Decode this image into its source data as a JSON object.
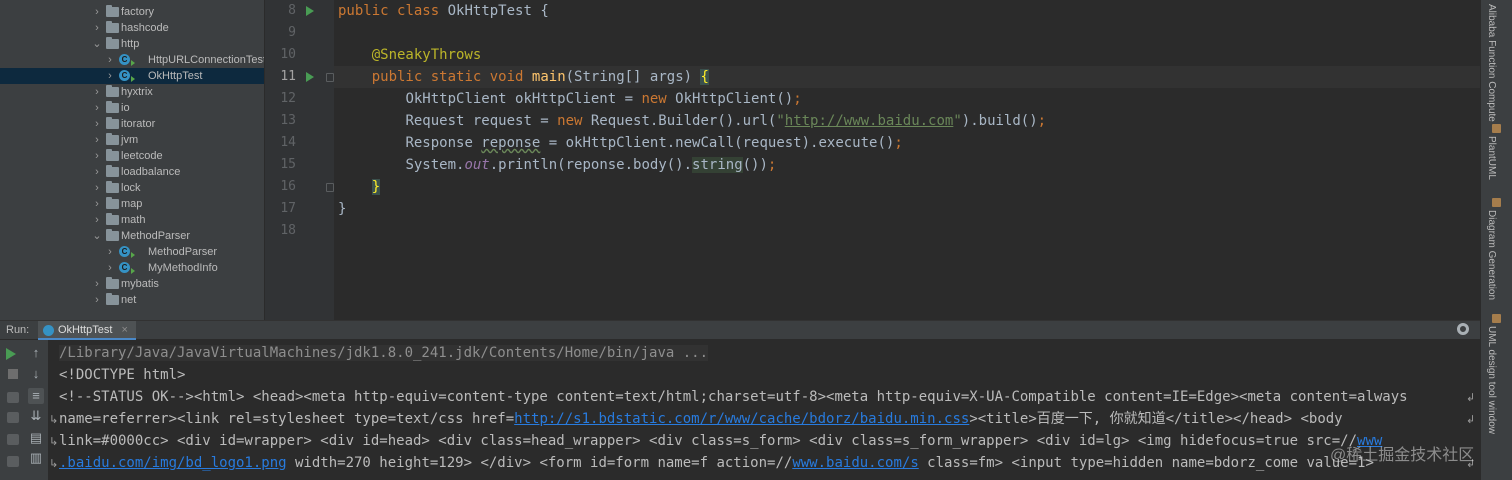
{
  "project_tree": {
    "items": [
      {
        "label": "factory",
        "kind": "folder",
        "expanded": false,
        "depth": 0
      },
      {
        "label": "hashcode",
        "kind": "folder",
        "expanded": false,
        "depth": 0
      },
      {
        "label": "http",
        "kind": "folder",
        "expanded": true,
        "depth": 0
      },
      {
        "label": "HttpURLConnectionTest",
        "kind": "class",
        "expanded": false,
        "depth": 1
      },
      {
        "label": "OkHttpTest",
        "kind": "class",
        "expanded": false,
        "depth": 1,
        "selected": true
      },
      {
        "label": "hyxtrix",
        "kind": "folder",
        "expanded": false,
        "depth": 0
      },
      {
        "label": "io",
        "kind": "folder",
        "expanded": false,
        "depth": 0
      },
      {
        "label": "itorator",
        "kind": "folder",
        "expanded": false,
        "depth": 0
      },
      {
        "label": "jvm",
        "kind": "folder",
        "expanded": false,
        "depth": 0
      },
      {
        "label": "leetcode",
        "kind": "folder",
        "expanded": false,
        "depth": 0
      },
      {
        "label": "loadbalance",
        "kind": "folder",
        "expanded": false,
        "depth": 0
      },
      {
        "label": "lock",
        "kind": "folder",
        "expanded": false,
        "depth": 0
      },
      {
        "label": "map",
        "kind": "folder",
        "expanded": false,
        "depth": 0
      },
      {
        "label": "math",
        "kind": "folder",
        "expanded": false,
        "depth": 0
      },
      {
        "label": "MethodParser",
        "kind": "folder",
        "expanded": true,
        "depth": 0
      },
      {
        "label": "MethodParser",
        "kind": "class",
        "expanded": false,
        "depth": 1
      },
      {
        "label": "MyMethodInfo",
        "kind": "class",
        "expanded": false,
        "depth": 1
      },
      {
        "label": "mybatis",
        "kind": "folder",
        "expanded": false,
        "depth": 0
      },
      {
        "label": "net",
        "kind": "folder",
        "expanded": false,
        "depth": 0
      }
    ]
  },
  "editor": {
    "line_numbers": [
      "8",
      "9",
      "10",
      "11",
      "12",
      "13",
      "14",
      "15",
      "16",
      "17",
      "18"
    ],
    "current_line": "11",
    "l8": {
      "kw1": "public",
      "kw2": "class",
      "rest": " OkHttpTest {"
    },
    "l10": {
      "annotation": "@SneakyThrows"
    },
    "l11": {
      "kw1": "public",
      "kw2": "static",
      "kw3": "void",
      "fn": "main",
      "params": "(String[] args) ",
      "brace": "{"
    },
    "l12": {
      "a": "OkHttpClient okHttpClient = ",
      "kw": "new",
      "b": " OkHttpClient()",
      "semi": ";"
    },
    "l13": {
      "a": "Request request = ",
      "kw": "new",
      "b": " Request.Builder().url(",
      "q1": "\"",
      "url": "http://www.baidu.com",
      "q2": "\"",
      "c": ").build()",
      "semi": ";"
    },
    "l14": {
      "a": "Response ",
      "var": "reponse",
      "b": " = okHttpClient.newCall(request).execute()",
      "semi": ";"
    },
    "l15": {
      "a": "System.",
      "field": "out",
      "b": ".println(reponse.body().",
      "method": "string",
      "c": "())",
      "semi": ";"
    },
    "l16": {
      "brace": "}"
    },
    "l17": {
      "brace": "}"
    }
  },
  "right_strip": {
    "tools": [
      "Alibaba Function Compute",
      "PlantUML",
      "Diagram Generation",
      "UML design tool window"
    ]
  },
  "run_panel": {
    "label": "Run:",
    "tab_title": "OkHttpTest",
    "tab_close": "×",
    "console": {
      "line1": "/Library/Java/JavaVirtualMachines/jdk1.8.0_241.jdk/Contents/Home/bin/java ...",
      "line2": "<!DOCTYPE html>",
      "line3": "<!--STATUS OK--><html> <head><meta http-equiv=content-type content=text/html;charset=utf-8><meta http-equiv=X-UA-Compatible content=IE=Edge><meta content=always",
      "line4_a": "name=referrer><link rel=stylesheet type=text/css href=",
      "line4_link": "http://s1.bdstatic.com/r/www/cache/bdorz/baidu.min.css",
      "line4_b": "><title>百度一下, 你就知道</title></head> <body",
      "line5_a": "link=#0000cc> <div id=wrapper> <div id=head> <div class=head_wrapper> <div class=s_form> <div class=s_form_wrapper> <div id=lg> <img hidefocus=true src=//",
      "line5_link": "www",
      "line6_link1": ".baidu.com/img/bd_logo1.png",
      "line6_a": " width=270 height=129> </div> <form id=form name=f action=//",
      "line6_link2": "www.baidu.com/s",
      "line6_b": " class=fm> <input type=hidden name=bdorz_come value=1>"
    }
  },
  "watermark": "@稀土掘金技术社区"
}
